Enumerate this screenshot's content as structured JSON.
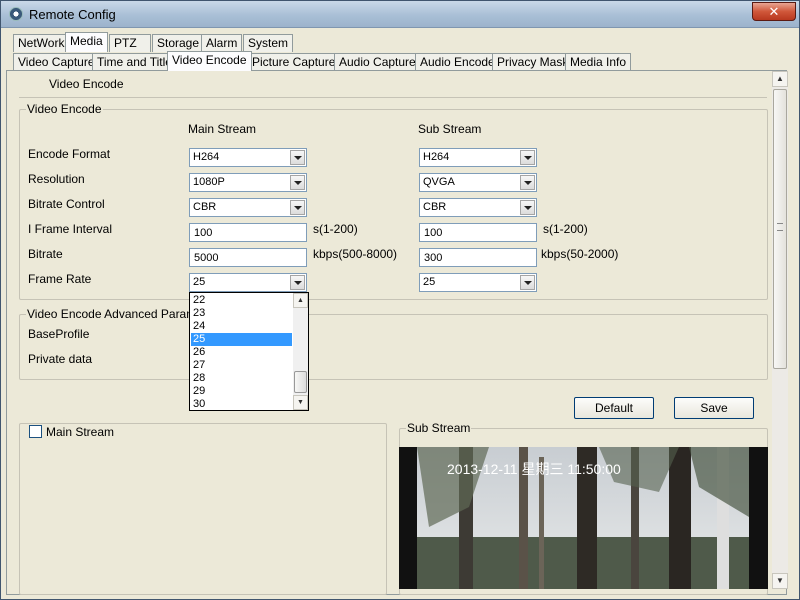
{
  "window": {
    "title": "Remote Config",
    "close_label": "✕"
  },
  "tabs": [
    {
      "label": "NetWork",
      "active": false
    },
    {
      "label": "Media",
      "active": true
    },
    {
      "label": "PTZ",
      "active": false
    },
    {
      "label": "Storage",
      "active": false
    },
    {
      "label": "Alarm",
      "active": false
    },
    {
      "label": "System",
      "active": false
    }
  ],
  "subtabs": [
    {
      "label": "Video Capture",
      "active": false
    },
    {
      "label": "Time and Title",
      "active": false
    },
    {
      "label": "Video Encode",
      "active": true
    },
    {
      "label": "Picture Capture",
      "active": false
    },
    {
      "label": "Audio Capture",
      "active": false
    },
    {
      "label": "Audio Encode",
      "active": false
    },
    {
      "label": "Privacy Mask",
      "active": false
    },
    {
      "label": "Media Info",
      "active": false
    }
  ],
  "page_heading": "Video Encode",
  "encode_group": {
    "title": "Video Encode",
    "main_header": "Main Stream",
    "sub_header": "Sub Stream",
    "rows": {
      "encode_format": {
        "label": "Encode Format",
        "main": "H264",
        "sub": "H264"
      },
      "resolution": {
        "label": "Resolution",
        "main": "1080P",
        "sub": "QVGA"
      },
      "bitrate_control": {
        "label": "Bitrate Control",
        "main": "CBR",
        "sub": "CBR"
      },
      "iframe_interval": {
        "label": "I Frame Interval",
        "main": "100",
        "main_hint": "s(1-200)",
        "sub": "100",
        "sub_hint": "s(1-200)"
      },
      "bitrate": {
        "label": "Bitrate",
        "main": "5000",
        "main_hint": "kbps(500-8000)",
        "sub": "300",
        "sub_hint": "kbps(50-2000)"
      },
      "frame_rate": {
        "label": "Frame Rate",
        "main": "25",
        "sub": "25"
      }
    }
  },
  "frame_rate_dropdown": {
    "options": [
      "22",
      "23",
      "24",
      "25",
      "26",
      "27",
      "28",
      "29",
      "30"
    ],
    "selected": "25"
  },
  "advanced_group": {
    "title": "Video Encode Advanced Paramete",
    "base_profile_label": "BaseProfile",
    "private_data_label": "Private data"
  },
  "buttons": {
    "default": "Default",
    "save": "Save"
  },
  "preview": {
    "main_label": "Main Stream",
    "main_checked": false,
    "sub_label": "Sub Stream",
    "osd_text": "2013-12-11 星期三 11:50:00"
  },
  "scrollbar": {
    "up": "▲",
    "down": "▼"
  },
  "colors": {
    "highlight": "#3399ff",
    "titlebar": "#a9bfd6",
    "close": "#d0573a"
  }
}
